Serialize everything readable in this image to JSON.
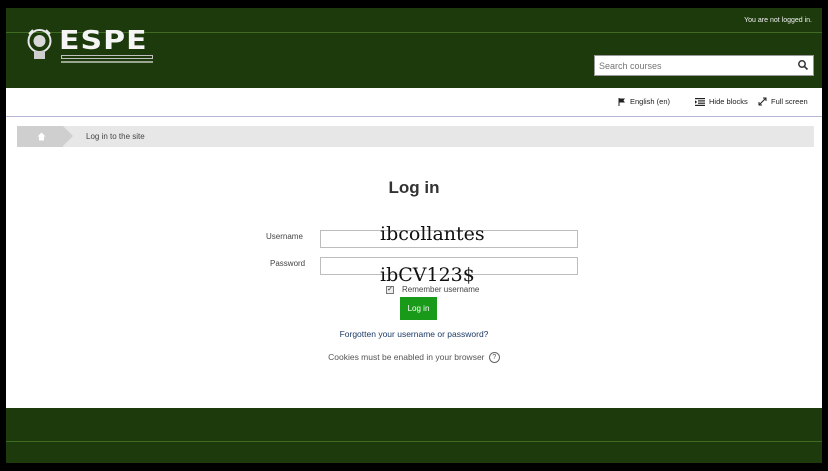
{
  "header": {
    "login_status": "You are not logged in.",
    "logo_text": "ESPE",
    "search_placeholder": "Search courses",
    "colors": {
      "header_bg": "#1c3a0c",
      "accent_green": "#1a9a19"
    }
  },
  "navbar": {
    "language": "English (en)",
    "hide_blocks": "Hide blocks",
    "full_screen": "Full screen"
  },
  "breadcrumb": {
    "home_icon": "home-icon",
    "current": "Log in to the site"
  },
  "login": {
    "title": "Log in",
    "username_label": "Username",
    "username_value": "ibcollantes",
    "password_label": "Password",
    "password_value": "ibCV123$",
    "remember_label": "Remember username",
    "remember_checked": true,
    "submit_label": "Log in",
    "forgot_link": "Forgotten your username or password?",
    "cookies_note": "Cookies must be enabled in your browser"
  }
}
